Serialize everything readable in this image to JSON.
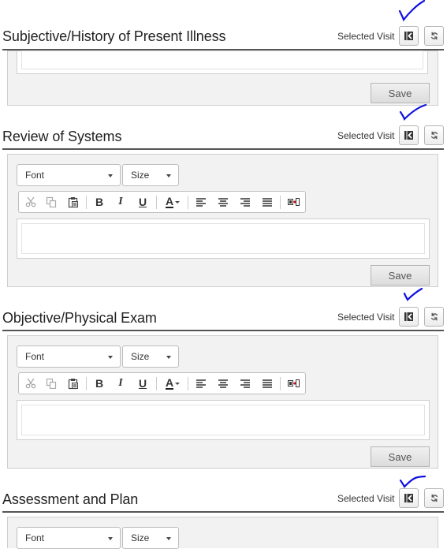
{
  "selected_visit_label": "Selected Visit",
  "save_label": "Save",
  "sections": [
    {
      "title": "Subjective/History of Present Illness"
    },
    {
      "title": "Review of Systems",
      "font_label": "Font",
      "size_label": "Size"
    },
    {
      "title": "Objective/Physical Exam",
      "font_label": "Font",
      "size_label": "Size"
    },
    {
      "title": "Assessment and Plan",
      "font_label": "Font",
      "size_label": "Size"
    }
  ],
  "toolbar": {
    "bold": "B",
    "italic": "I",
    "underline": "U",
    "font_color": "A"
  },
  "icons": [
    "cut-icon",
    "copy-icon",
    "paste-icon",
    "bold-icon",
    "italic-icon",
    "underline-icon",
    "font-color-icon",
    "align-left-icon",
    "align-center-icon",
    "align-right-icon",
    "justify-icon",
    "insert-field-icon",
    "collapse-icon",
    "refresh-icon",
    "checkmark-annotation"
  ],
  "colors": {
    "annotation": "#1010e0",
    "rule": "#555555",
    "panel": "#f2f2f2"
  }
}
